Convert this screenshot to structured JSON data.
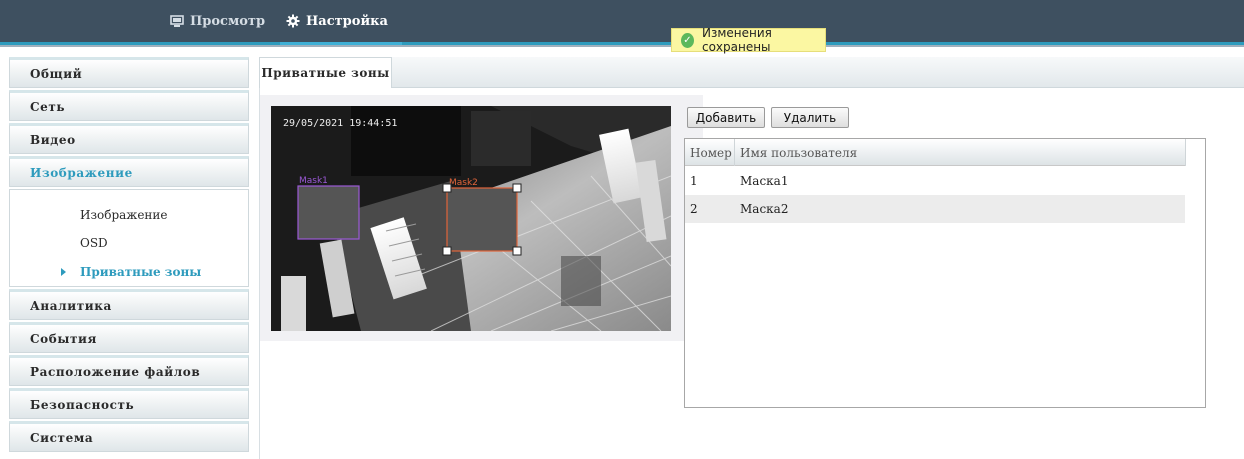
{
  "topnav": {
    "items": [
      {
        "label": "Просмотр",
        "icon": "monitor-icon",
        "active": false
      },
      {
        "label": "Настройка",
        "icon": "gear-icon",
        "active": true
      }
    ]
  },
  "toast": {
    "text": "Изменения сохранены",
    "icon": "check-circle-icon"
  },
  "sidebar": {
    "items": [
      {
        "label": "Общий"
      },
      {
        "label": "Сеть"
      },
      {
        "label": "Видео"
      },
      {
        "label": "Изображение",
        "active": true
      },
      {
        "label": "Аналитика"
      },
      {
        "label": "События"
      },
      {
        "label": "Расположение файлов"
      },
      {
        "label": "Безопасность"
      },
      {
        "label": "Система"
      }
    ],
    "subitems": [
      {
        "label": "Изображение"
      },
      {
        "label": "OSD"
      },
      {
        "label": "Приватные зоны",
        "active": true
      }
    ]
  },
  "tab": {
    "label": "Приватные зоны"
  },
  "preview": {
    "timestamp": "29/05/2021 19:44:51",
    "masks": [
      {
        "label": "Mask1",
        "color": "#9b59d6"
      },
      {
        "label": "Mask2",
        "color": "#e0643a"
      }
    ]
  },
  "buttons": {
    "add": "Добавить",
    "delete": "Удалить"
  },
  "table": {
    "headers": [
      "Номер",
      "Имя пользователя"
    ],
    "rows": [
      {
        "num": "1",
        "name": "Маска1"
      },
      {
        "num": "2",
        "name": "Маска2"
      }
    ]
  }
}
